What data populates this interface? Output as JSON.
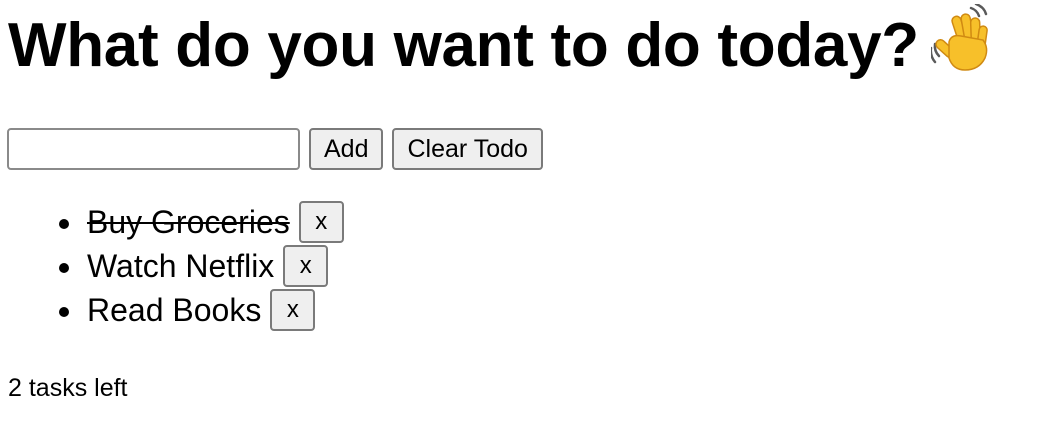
{
  "header": {
    "title": "What do you want to do today?",
    "emoji_icon": "waving-hand-icon"
  },
  "form": {
    "input_value": "",
    "input_placeholder": "",
    "add_label": "Add",
    "clear_label": "Clear Todo"
  },
  "todos": [
    {
      "text": "Buy Groceries",
      "completed": true,
      "delete_label": "x"
    },
    {
      "text": "Watch Netflix",
      "completed": false,
      "delete_label": "x"
    },
    {
      "text": "Read Books",
      "completed": false,
      "delete_label": "x"
    }
  ],
  "footer": {
    "tasks_left": "2 tasks left"
  },
  "colors": {
    "background": "#ffffff",
    "text": "#000000",
    "button_bg": "#efefef",
    "button_border": "#7a7a7a",
    "emoji_yellow": "#f7c02a"
  }
}
